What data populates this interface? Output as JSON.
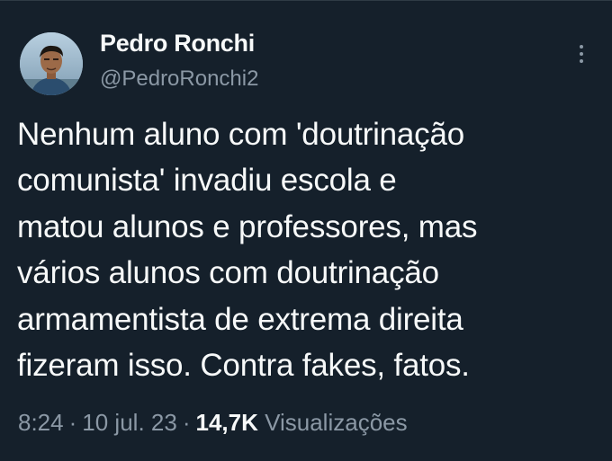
{
  "author": {
    "name": "Pedro Ronchi",
    "handle": "@PedroRonchi2"
  },
  "tweet": {
    "lines": [
      "Nenhum aluno com 'doutrinação",
      "comunista' invadiu escola e",
      "matou alunos e professores, mas",
      "vários alunos com doutrinação",
      "armamentista de extrema direita",
      "fizeram isso. Contra fakes, fatos."
    ]
  },
  "meta": {
    "time": "8:24",
    "separator": "·",
    "date": "10 jul. 23",
    "views_count": "14,7K",
    "views_label": "Visualizações"
  },
  "icons": {
    "more": "more-vertical-icon"
  },
  "colors": {
    "background": "#15202b",
    "text": "#f7f9f9",
    "secondary": "#8b98a5"
  }
}
